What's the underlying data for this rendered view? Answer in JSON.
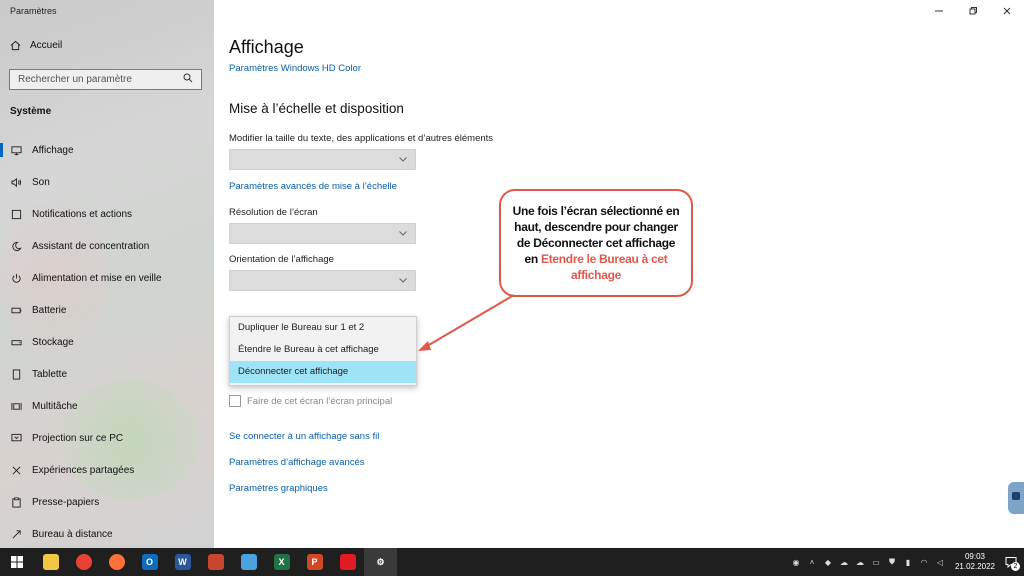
{
  "window": {
    "title": "Paramètres",
    "controls": [
      "minimize-icon",
      "maximize-icon",
      "close-icon"
    ]
  },
  "sidebar": {
    "home_label": "Accueil",
    "search_placeholder": "Rechercher un paramètre",
    "section_title": "Système",
    "items": [
      {
        "label": "Affichage",
        "icon": "display-icon",
        "active": true
      },
      {
        "label": "Son",
        "icon": "speaker-icon"
      },
      {
        "label": "Notifications et actions",
        "icon": "notification-icon"
      },
      {
        "label": "Assistant de concentration",
        "icon": "moon-icon"
      },
      {
        "label": "Alimentation et mise en veille",
        "icon": "power-icon"
      },
      {
        "label": "Batterie",
        "icon": "battery-icon"
      },
      {
        "label": "Stockage",
        "icon": "storage-icon"
      },
      {
        "label": "Tablette",
        "icon": "tablet-icon"
      },
      {
        "label": "Multitâche",
        "icon": "multitask-icon"
      },
      {
        "label": "Projection sur ce PC",
        "icon": "projection-icon"
      },
      {
        "label": "Expériences partagées",
        "icon": "shared-icon"
      },
      {
        "label": "Presse-papiers",
        "icon": "clipboard-icon"
      },
      {
        "label": "Bureau à distance",
        "icon": "remote-icon"
      }
    ]
  },
  "main": {
    "title": "Affichage",
    "hdr_link": "Paramètres Windows HD Color",
    "section_title": "Mise à l’échelle et disposition",
    "scale_label": "Modifier la taille du texte, des applications et d’autres éléments",
    "scale_advanced_link": "Paramètres avancés de mise à l’échelle",
    "resolution_label": "Résolution de l’écran",
    "orientation_label": "Orientation de l’affichage",
    "multi_display_options": [
      {
        "label": "Dupliquer le Bureau sur 1 et 2",
        "selected": false
      },
      {
        "label": "Étendre le Bureau à cet affichage",
        "selected": false
      },
      {
        "label": "Déconnecter cet affichage",
        "selected": true
      }
    ],
    "primary_checkbox_label": "Faire de cet écran l’écran principal",
    "wireless_link": "Se connecter à un affichage sans fil",
    "advanced_display_link": "Paramètres d’affichage avancés",
    "graphics_link": "Paramètres graphiques"
  },
  "callout": {
    "text": "Une fois l’écran sélectionné en haut, descendre pour changer de Déconnecter cet affichage en",
    "highlight": "Etendre le Bureau à cet affichage",
    "border_color": "#e0584a"
  },
  "taskbar": {
    "apps": [
      {
        "icon": "file-explorer-icon",
        "color": "#f2c744",
        "glyph": ""
      },
      {
        "icon": "chrome-icon",
        "color": "#e94235",
        "glyph": ""
      },
      {
        "icon": "firefox-icon",
        "color": "#ff7139",
        "glyph": ""
      },
      {
        "icon": "outlook-icon",
        "color": "#0f6cbd",
        "glyph": "O"
      },
      {
        "icon": "word-icon",
        "color": "#2b579a",
        "glyph": "W"
      },
      {
        "icon": "app-icon",
        "color": "#c8452f",
        "glyph": ""
      },
      {
        "icon": "scanner-icon",
        "color": "#4aa3df",
        "glyph": ""
      },
      {
        "icon": "excel-icon",
        "color": "#217346",
        "glyph": "X"
      },
      {
        "icon": "powerpoint-icon",
        "color": "#d24726",
        "glyph": "P"
      },
      {
        "icon": "acrobat-icon",
        "color": "#e11b22",
        "glyph": ""
      },
      {
        "icon": "settings-icon",
        "color": "#3a3a3a",
        "glyph": "⚙",
        "active": true
      }
    ],
    "time": "09:03",
    "date": "21.02.2022",
    "notification_count": "2"
  }
}
